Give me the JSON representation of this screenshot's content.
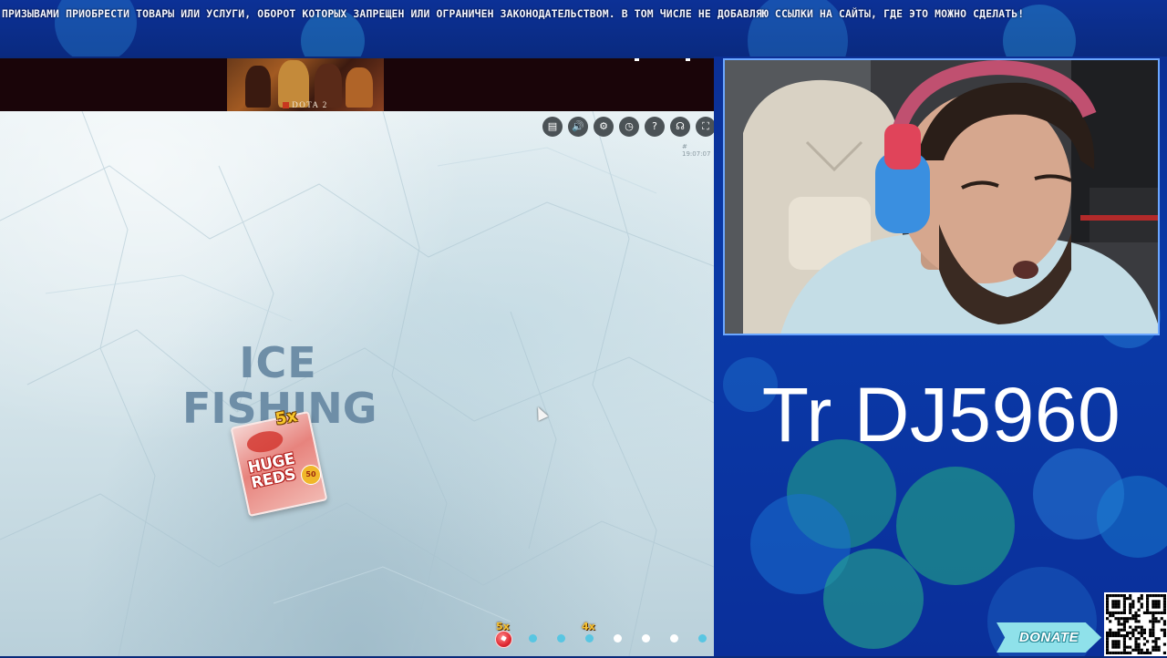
{
  "ticker": {
    "text": "ПРИЗЫВАМИ ПРИОБРЕСТИ ТОВАРЫ ИЛИ УСЛУГИ, ОБОРОТ КОТОРЫХ ЗАПРЕЩЕН ИЛИ ОГРАНИЧЕН ЗАКОНОДАТЕЛЬСТВОМ. В ТОМ ЧИСЛЕ НЕ ДОБАВЛЯЮ ССЫЛКИ НА САЙТЫ, ГДЕ ЭТО МОЖНО СДЕЛАТЬ!"
  },
  "game": {
    "banner": {
      "label": "DOTA 2",
      "logo_icon": "dota-logo-icon"
    },
    "toolbar_icons": [
      {
        "name": "chat-icon",
        "glyph": "▤"
      },
      {
        "name": "volume-icon",
        "glyph": "🔊"
      },
      {
        "name": "settings-icon",
        "glyph": "⚙"
      },
      {
        "name": "history-icon",
        "glyph": "◷"
      },
      {
        "name": "help-icon",
        "glyph": "?"
      },
      {
        "name": "headset-icon",
        "glyph": "☊"
      },
      {
        "name": "fullscreen-icon",
        "glyph": "⛶"
      }
    ],
    "timestamp": "# 19:07:07",
    "logo": {
      "line1": "ICE",
      "line2": "FISHING"
    },
    "card": {
      "multiplier": "5x",
      "line1": "HUGE",
      "line2": "REDS",
      "badge": "50"
    },
    "track": {
      "label_left": "5x",
      "label_right": "4x",
      "dot_colors": [
        "#58c6e2",
        "#58c6e2",
        "#58c6e2",
        "#ffffff",
        "#ffffff",
        "#ffffff",
        "#58c6e2"
      ]
    }
  },
  "sidebar": {
    "handle_text": "Tr DJ5960",
    "donate_label": "DONATE",
    "qr_icon": "qr-code-icon"
  }
}
